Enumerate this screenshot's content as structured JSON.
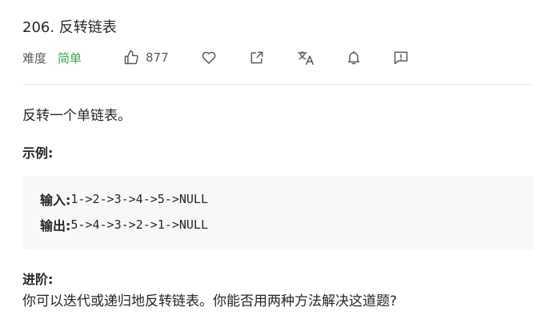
{
  "problem": {
    "title": "206. 反转链表",
    "difficulty_label": "难度",
    "difficulty_value": "简单",
    "like_count": "877"
  },
  "icons": {
    "like": "thumbs-up-icon",
    "favorite": "heart-icon",
    "share": "share-icon",
    "translate": "translate-icon",
    "notify": "bell-icon",
    "feedback": "feedback-icon"
  },
  "colors": {
    "easy": "#43a047",
    "code_background": "#f7f8fa"
  },
  "content": {
    "description": "反转一个单链表。",
    "example_heading": "示例:",
    "example": {
      "input_label": "输入:",
      "input_value": "1->2->3->4->5->NULL",
      "output_label": "输出:",
      "output_value": "5->4->3->2->1->NULL"
    },
    "advanced_heading": "进阶:",
    "advanced_text": "你可以迭代或递归地反转链表。你能否用两种方法解决这道题?"
  }
}
